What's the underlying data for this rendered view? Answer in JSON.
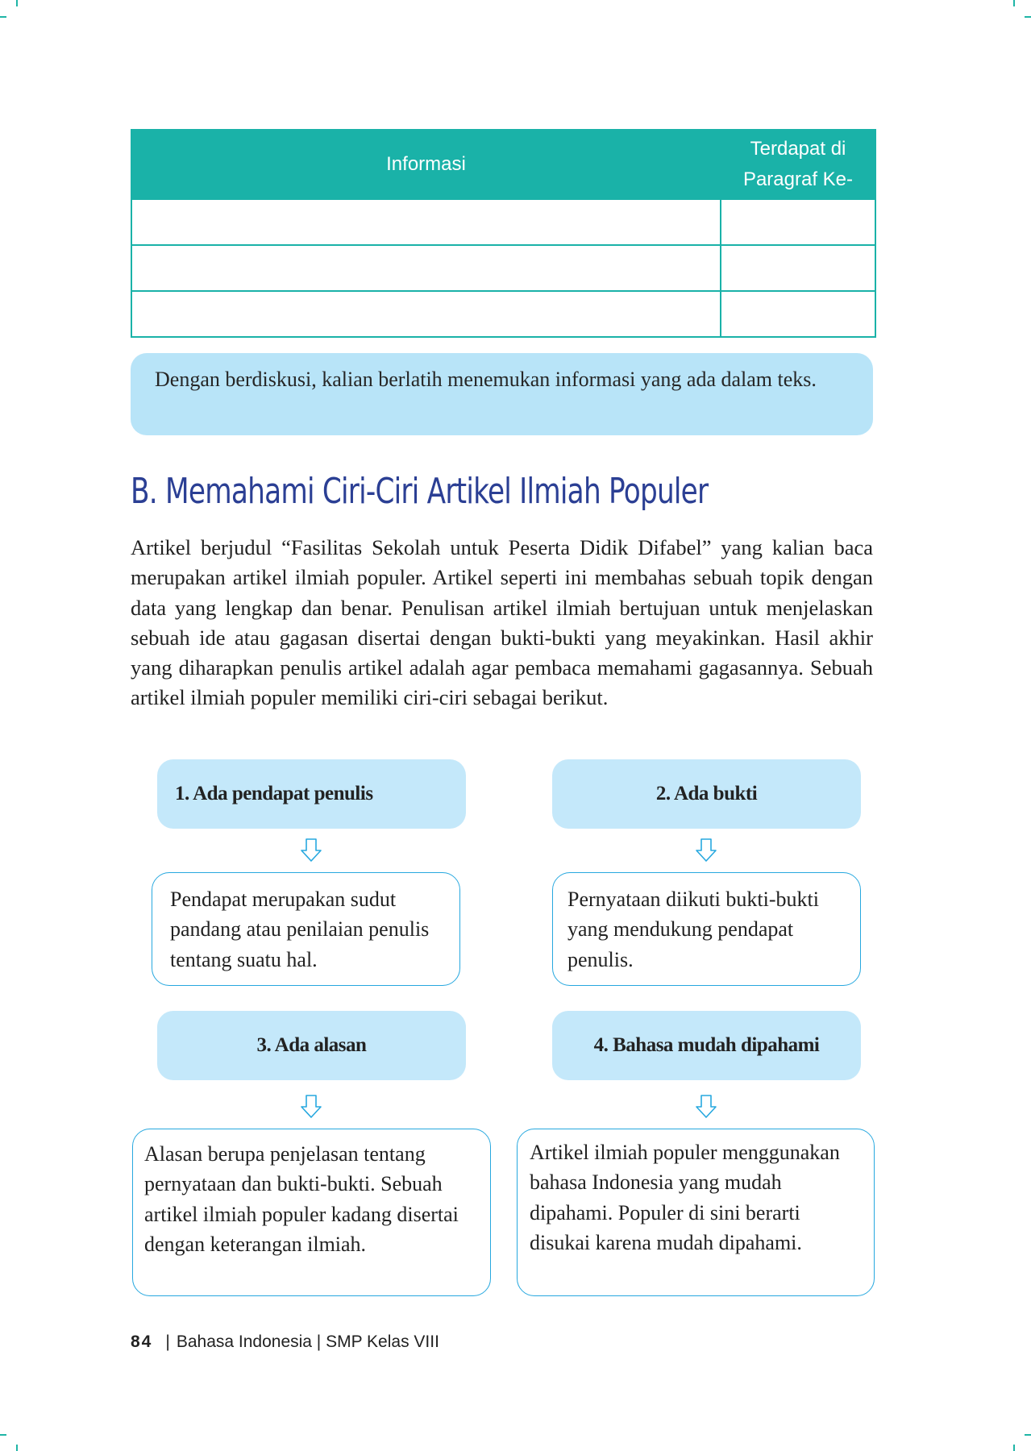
{
  "colors": {
    "table_header": "#1ab2a8",
    "note_box": "#b8e4f8",
    "heading": "#2b3f94",
    "card_fill": "#c4e8fa",
    "card_border": "#27a8df",
    "crop_marks": "#1fb5a6"
  },
  "table": {
    "headers": [
      "Informasi",
      "Terdapat di Paragraf Ke-"
    ],
    "rows": [
      [
        "",
        ""
      ],
      [
        "",
        ""
      ],
      [
        "",
        ""
      ]
    ]
  },
  "note": "Dengan berdiskusi, kalian berlatih menemukan informasi yang ada dalam teks.",
  "section": {
    "heading": "B. Memahami Ciri-Ciri Artikel Ilmiah Populer",
    "paragraph": "Artikel berjudul “Fasilitas Sekolah untuk Peserta Didik Difabel” yang kalian baca merupakan artikel ilmiah populer. Artikel seperti ini membahas sebuah topik dengan data yang lengkap dan benar. Penulisan artikel ilmiah bertujuan untuk menjelaskan sebuah ide atau gagasan disertai dengan bukti-bukti yang meyakinkan. Hasil akhir yang diharapkan penulis artikel adalah agar pembaca memahami gagasannya. Sebuah artikel ilmiah populer memiliki ciri-ciri sebagai berikut."
  },
  "characteristics": [
    {
      "title": "1. Ada pendapat penulis",
      "description": "Pendapat merupakan sudut pandang atau penilaian penulis tentang suatu hal.",
      "icon": "down-arrow-icon"
    },
    {
      "title": "2. Ada bukti",
      "description": "Pernyataan diikuti bukti-bukti yang mendukung pendapat penulis.",
      "icon": "down-arrow-icon"
    },
    {
      "title": "3. Ada alasan",
      "description": "Alasan berupa penjelasan tentang pernyataan dan bukti-bukti. Sebuah artikel ilmiah populer kadang disertai dengan keterangan ilmiah.",
      "icon": "down-arrow-icon"
    },
    {
      "title": "4. Bahasa mudah dipahami",
      "description": "Artikel ilmiah populer menggunakan bahasa Indonesia yang mudah dipahami. Populer di sini berarti disukai karena mudah dipahami.",
      "icon": "down-arrow-icon"
    }
  ],
  "footer": {
    "page_number": "84",
    "separator": "|",
    "text": "Bahasa Indonesia | SMP Kelas VIII"
  }
}
